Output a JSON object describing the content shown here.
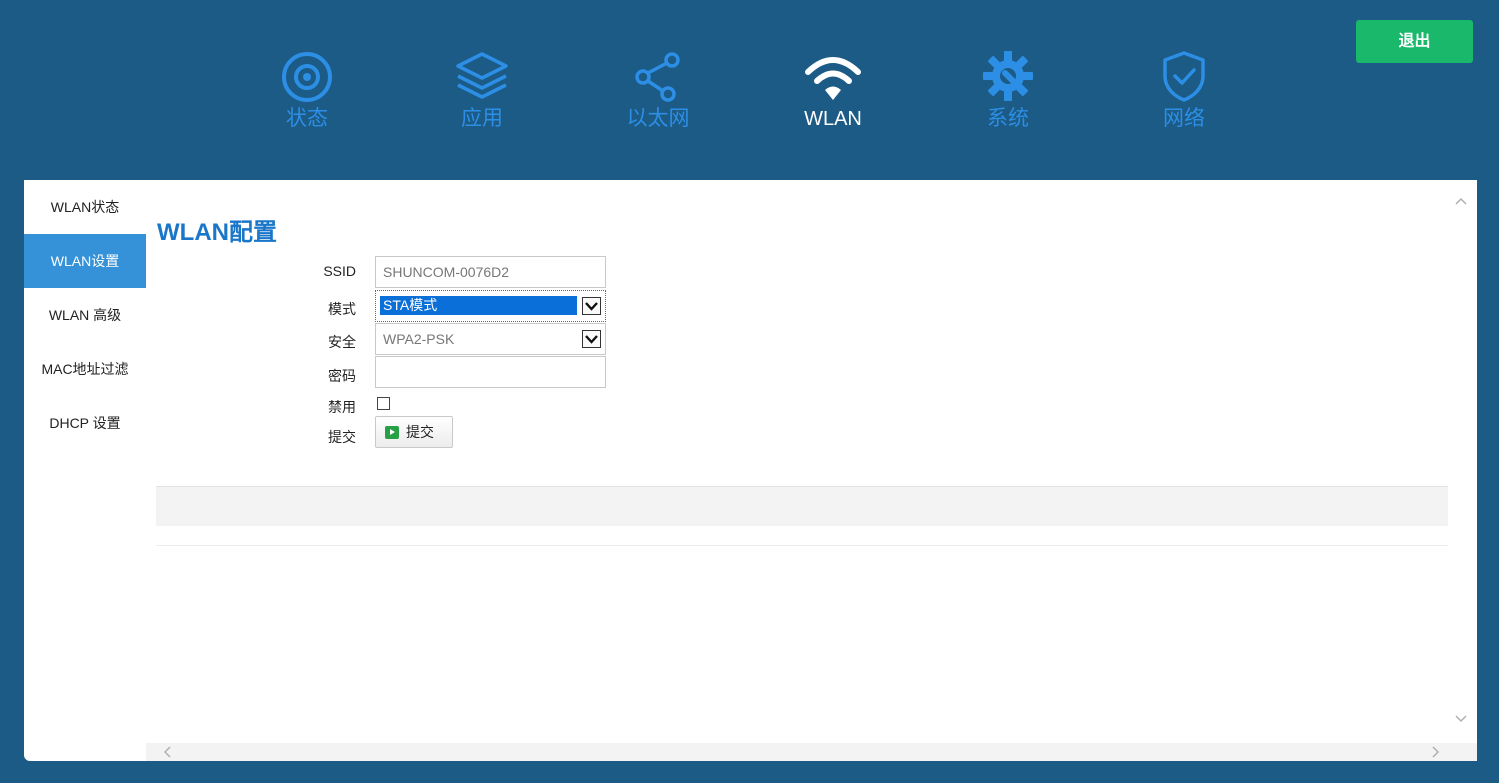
{
  "nav": {
    "items": [
      {
        "label": "状态",
        "icon": "status-radio-icon"
      },
      {
        "label": "应用",
        "icon": "layers-icon"
      },
      {
        "label": "以太网",
        "icon": "share-nodes-icon"
      },
      {
        "label": "WLAN",
        "icon": "wifi-icon"
      },
      {
        "label": "系统",
        "icon": "gear-icon"
      },
      {
        "label": "网络",
        "icon": "shield-check-icon"
      }
    ],
    "active": "WLAN",
    "logout_label": "退出"
  },
  "sidebar": {
    "items": [
      {
        "label": "WLAN状态"
      },
      {
        "label": "WLAN设置"
      },
      {
        "label": "WLAN 高级"
      },
      {
        "label": "MAC地址过滤"
      },
      {
        "label": "DHCP 设置"
      }
    ],
    "active": "WLAN设置"
  },
  "form": {
    "title": "WLAN配置",
    "ssid_label": "SSID",
    "ssid_value": "SHUNCOM-0076D2",
    "mode_label": "模式",
    "mode_value": "STA模式",
    "security_label": "安全",
    "security_value": "WPA2-PSK",
    "password_label": "密码",
    "password_value": "",
    "disable_label": "禁用",
    "submit_label": "提交",
    "submit_button": "提交"
  },
  "colors": {
    "background": "#1b5b85",
    "nav_inactive": "#2d8ee6",
    "logout": "#19b86b",
    "sidebar_active": "#3592d8",
    "title": "#1a76c8"
  }
}
